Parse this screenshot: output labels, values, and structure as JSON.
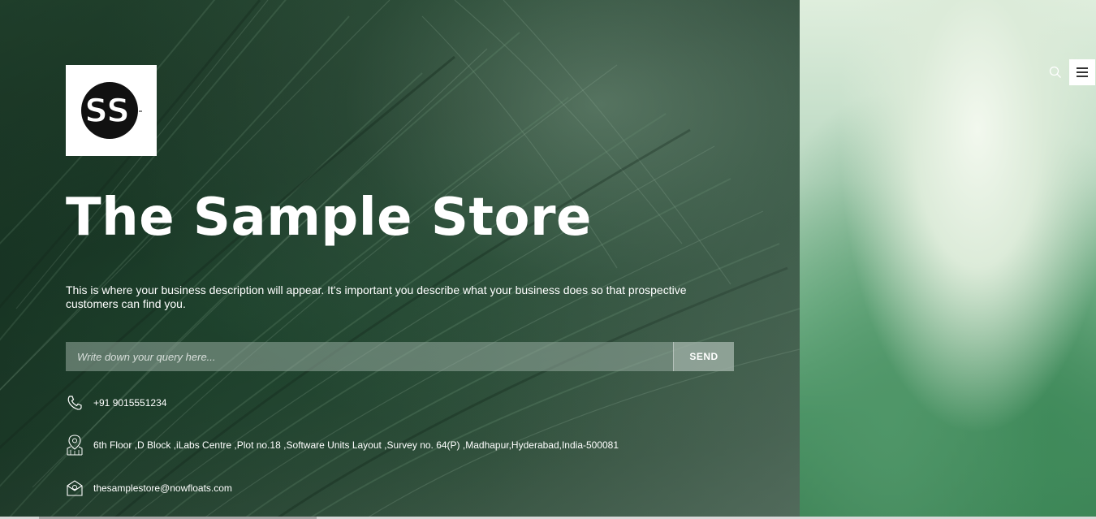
{
  "brand": {
    "logo_text": "SS",
    "title": "The Sample Store",
    "description": "This is where your business description will appear. It's important you describe what your business does so that prospective customers can find you."
  },
  "header": {
    "search_icon": "search-icon",
    "menu_icon": "hamburger-menu-icon"
  },
  "query": {
    "placeholder": "Write down your query here...",
    "value": "",
    "send_label": "SEND"
  },
  "contact": {
    "phone": "+91 9015551234",
    "address": "6th Floor ,D Block ,iLabs Centre ,Plot no.18 ,Software Units Layout ,Survey no. 64(P) ,Madhapur,Hyderabad,India-500081",
    "email": "thesamplestore@nowfloats.com"
  },
  "colors": {
    "text": "#ffffff",
    "menu_bg": "#ffffff"
  }
}
